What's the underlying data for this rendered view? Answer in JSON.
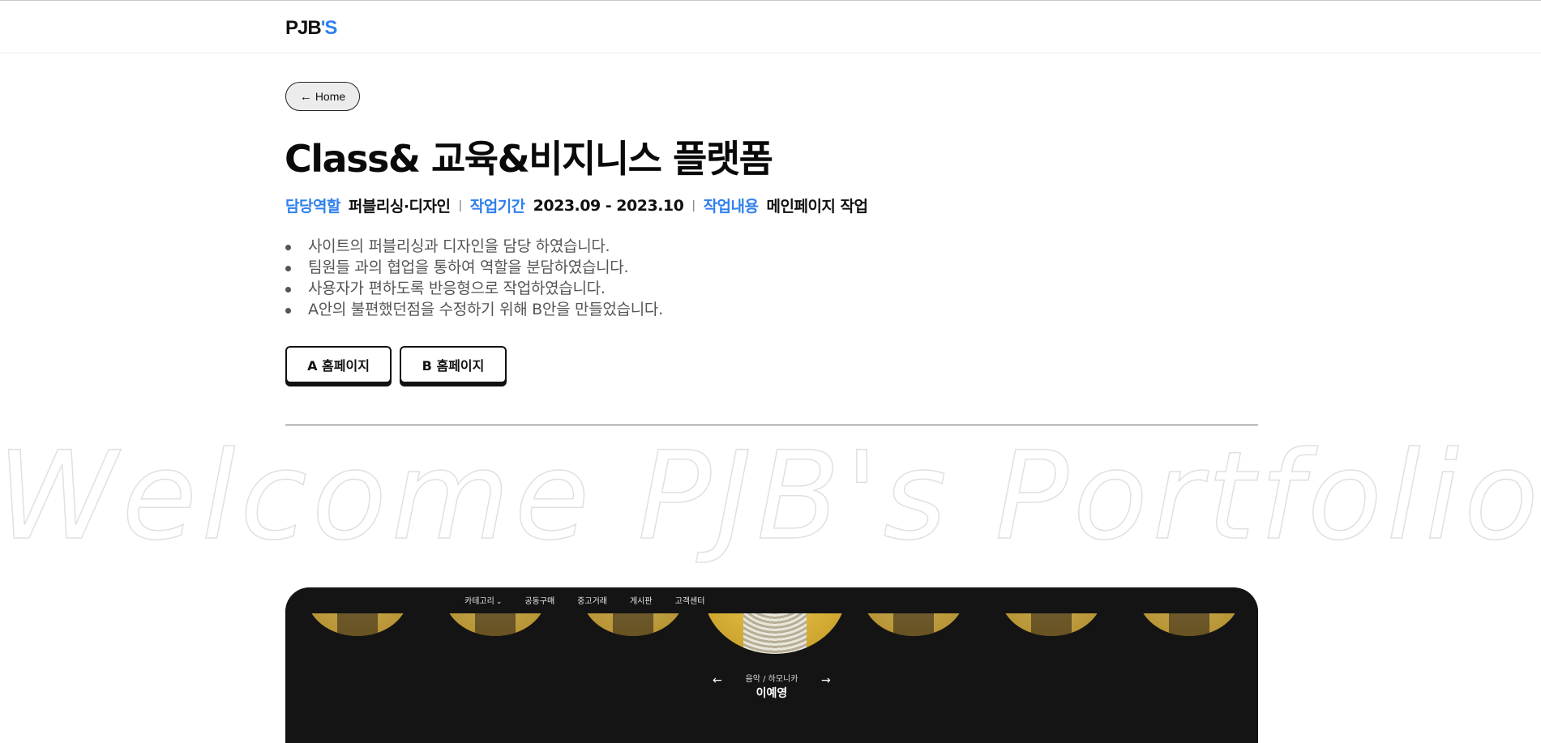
{
  "header": {
    "logo_main": "PJB",
    "logo_accent": "'S"
  },
  "nav_back": {
    "label": "Home",
    "icon": "arrow-left-icon"
  },
  "project": {
    "title": "Class& 교육&비지니스 플랫폼",
    "meta": [
      {
        "label": "담당역할",
        "value": "퍼블리싱·디자인"
      },
      {
        "label": "작업기간",
        "value": "2023.09 - 2023.10"
      },
      {
        "label": "작업내용",
        "value": "메인페이지 작업"
      }
    ],
    "separator": "|",
    "bullets": [
      "사이트의 퍼블리싱과 디자인을 담당 하였습니다.",
      "팀원들 과의 협업을 통하여 역할을 분담하였습니다.",
      "사용자가 편하도록 반응형으로 작업하였습니다.",
      "A안의 불편했던점을 수정하기 위해 B안을 만들었습니다."
    ],
    "buttons": {
      "a": "A 홈페이지",
      "b": "B 홈페이지"
    }
  },
  "welcome_text": "Welcome PJB's Portfolio",
  "preview": {
    "nav": [
      "카테고리",
      "공동구매",
      "중고거래",
      "게시판",
      "고객센터"
    ],
    "caption_sub": "음악 / 하모니카",
    "caption_name": "이예영",
    "colors": {
      "bg": "#141414",
      "gold": "#c19722"
    }
  },
  "colors": {
    "accent": "#2f80ed",
    "text": "#111111",
    "muted": "#555555"
  }
}
